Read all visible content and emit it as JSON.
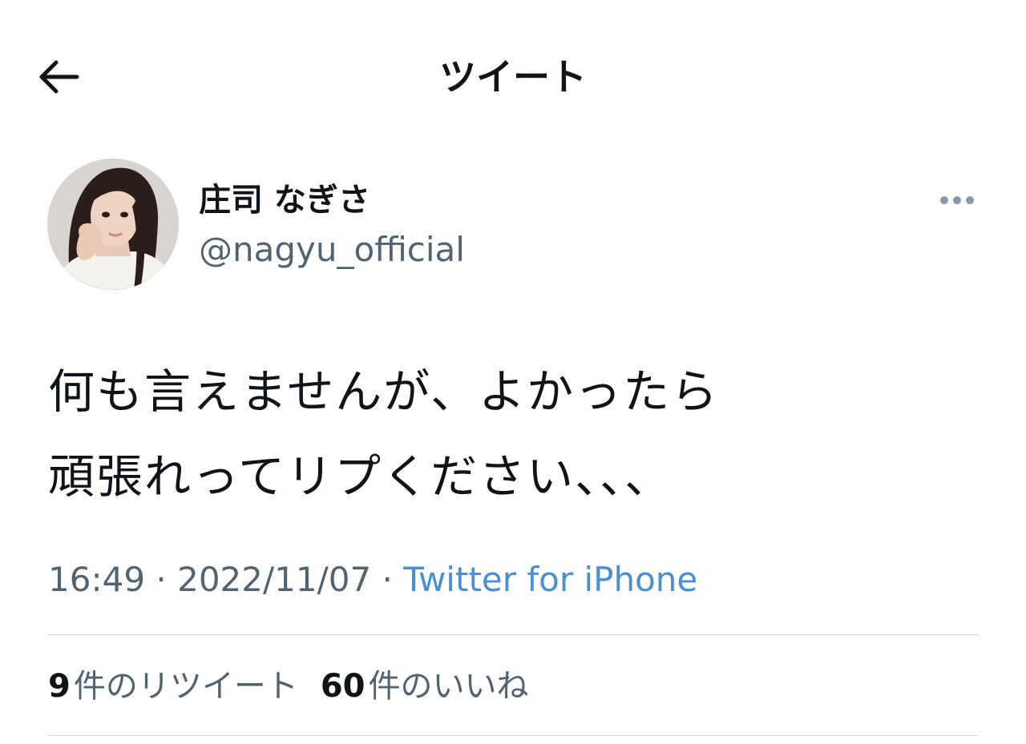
{
  "header": {
    "title": "ツイート",
    "back_icon": "arrow-left-icon"
  },
  "author": {
    "name": "庄司 なぎさ",
    "handle": "@nagyu_official",
    "avatar_icon": "user-avatar-photo"
  },
  "more_icon": "more-horizontal-icon",
  "tweet": {
    "lines": [
      "何も言えませんが、よかったら",
      "頑張れってリプください、、、"
    ]
  },
  "meta": {
    "time": "16:49",
    "separator": " · ",
    "date": "2022/11/07",
    "source": "Twitter for iPhone"
  },
  "stats": {
    "retweets_count": "9",
    "retweets_label": "件のリツイート",
    "likes_count": "60",
    "likes_label": "件のいいね"
  },
  "colors": {
    "text": "#0f1419",
    "secondary": "#536471",
    "link": "#4a8fd0",
    "divider": "#cfd9de"
  }
}
